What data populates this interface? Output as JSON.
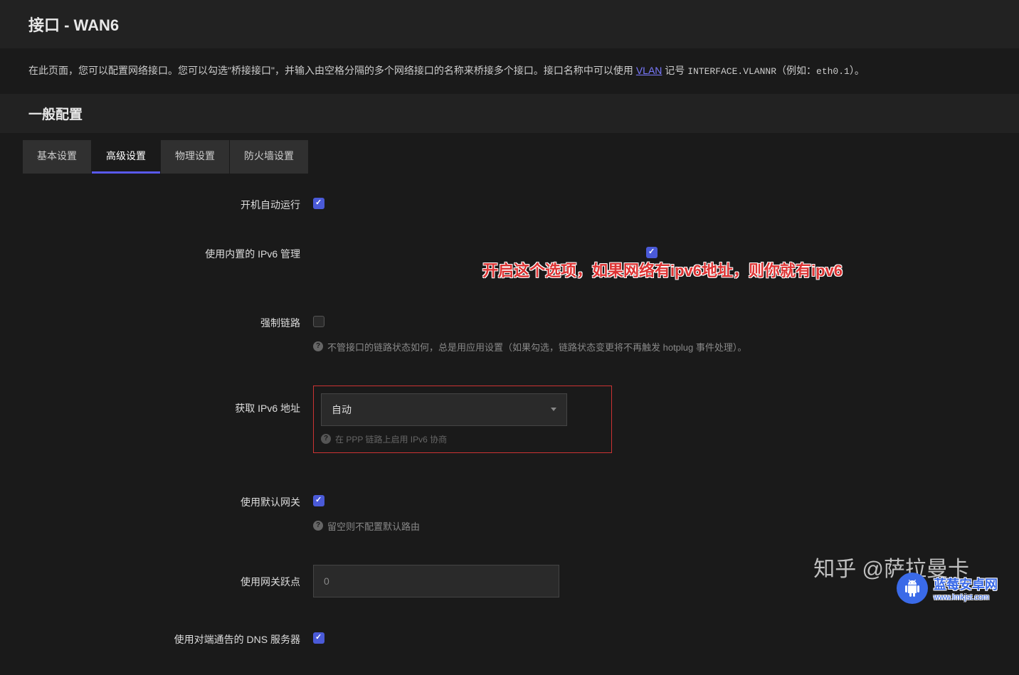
{
  "header": {
    "title": "接口 - WAN6"
  },
  "description": {
    "text_part1": "在此页面，您可以配置网络接口。您可以勾选\"桥接接口\"，并输入由空格分隔的多个网络接口的名称来桥接多个接口。接口名称中可以使用 ",
    "vlan_link": "VLAN",
    "text_part2": " 记号 ",
    "interface_notation": "INTERFACE.VLANNR",
    "text_part3": "（例如：",
    "example": "eth0.1",
    "text_part4": "）。"
  },
  "section": {
    "title": "一般配置"
  },
  "tabs": [
    {
      "label": "基本设置",
      "active": false
    },
    {
      "label": "高级设置",
      "active": true
    },
    {
      "label": "物理设置",
      "active": false
    },
    {
      "label": "防火墙设置",
      "active": false
    }
  ],
  "form": {
    "autostart": {
      "label": "开机自动运行",
      "checked": true
    },
    "ipv6_mgmt": {
      "label": "使用内置的 IPv6 管理",
      "checked": true,
      "annotation": "开启这个选项，如果网络有ipv6地址，则你就有ipv6"
    },
    "force_link": {
      "label": "强制链路",
      "checked": false,
      "hint": "不管接口的链路状态如何，总是用应用设置（如果勾选，链路状态变更将不再触发 hotplug 事件处理）。"
    },
    "ipv6_addr": {
      "label": "获取 IPv6 地址",
      "value": "自动",
      "hint": "在 PPP 链路上启用 IPv6 协商"
    },
    "default_gw": {
      "label": "使用默认网关",
      "checked": true,
      "hint": "留空则不配置默认路由"
    },
    "gw_metric": {
      "label": "使用网关跃点",
      "placeholder": "0"
    },
    "peer_dns": {
      "label": "使用对端通告的 DNS 服务器",
      "checked": true
    }
  },
  "watermarks": {
    "zhihu": "知乎 @萨拉曼卡",
    "site_name": "蓝莓安卓网",
    "site_url": "www.lmkjst.com"
  }
}
